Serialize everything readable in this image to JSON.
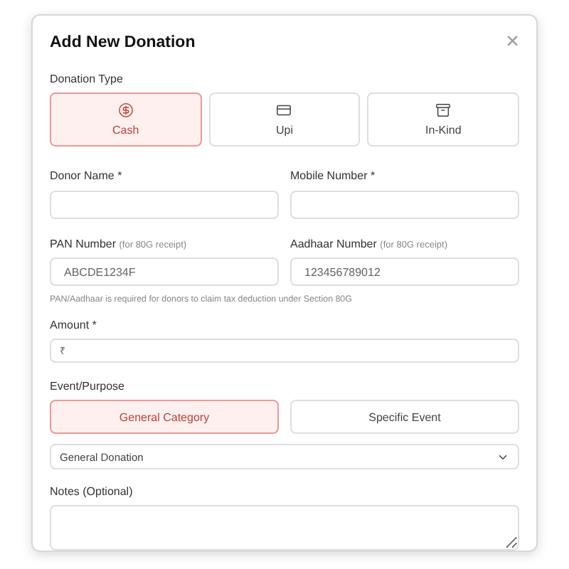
{
  "dialog": {
    "title": "Add New Donation",
    "close": "×"
  },
  "donation_type": {
    "label": "Donation Type",
    "options": [
      {
        "label": "Cash",
        "kind": "cash",
        "selected": true
      },
      {
        "label": "Upi",
        "kind": "upi",
        "selected": false
      },
      {
        "label": "In-Kind",
        "kind": "goods",
        "selected": false
      }
    ]
  },
  "rows": [
    [
      {
        "label": "Donor Name *"
      },
      {
        "label": "Mobile Number *"
      }
    ],
    [
      {
        "label": "PAN Number",
        "hint": "(for 80G receipt)",
        "placeholder": "ABCDE1234F"
      },
      {
        "label": "Aadhaar Number",
        "hint": "(for 80G receipt)",
        "placeholder": "123456789012"
      }
    ]
  ],
  "help_text": "PAN/Aadhaar is required for donors to claim tax deduction under Section 80G",
  "amount": {
    "label": "Amount *",
    "prefix": "₹"
  },
  "event_purpose": {
    "label": "Event/Purpose",
    "options": [
      {
        "label": "General Category",
        "selected": true
      },
      {
        "label": "Specific Event",
        "selected": false
      }
    ],
    "select_value": "General Donation"
  },
  "notes": {
    "label": "Notes (Optional)"
  }
}
